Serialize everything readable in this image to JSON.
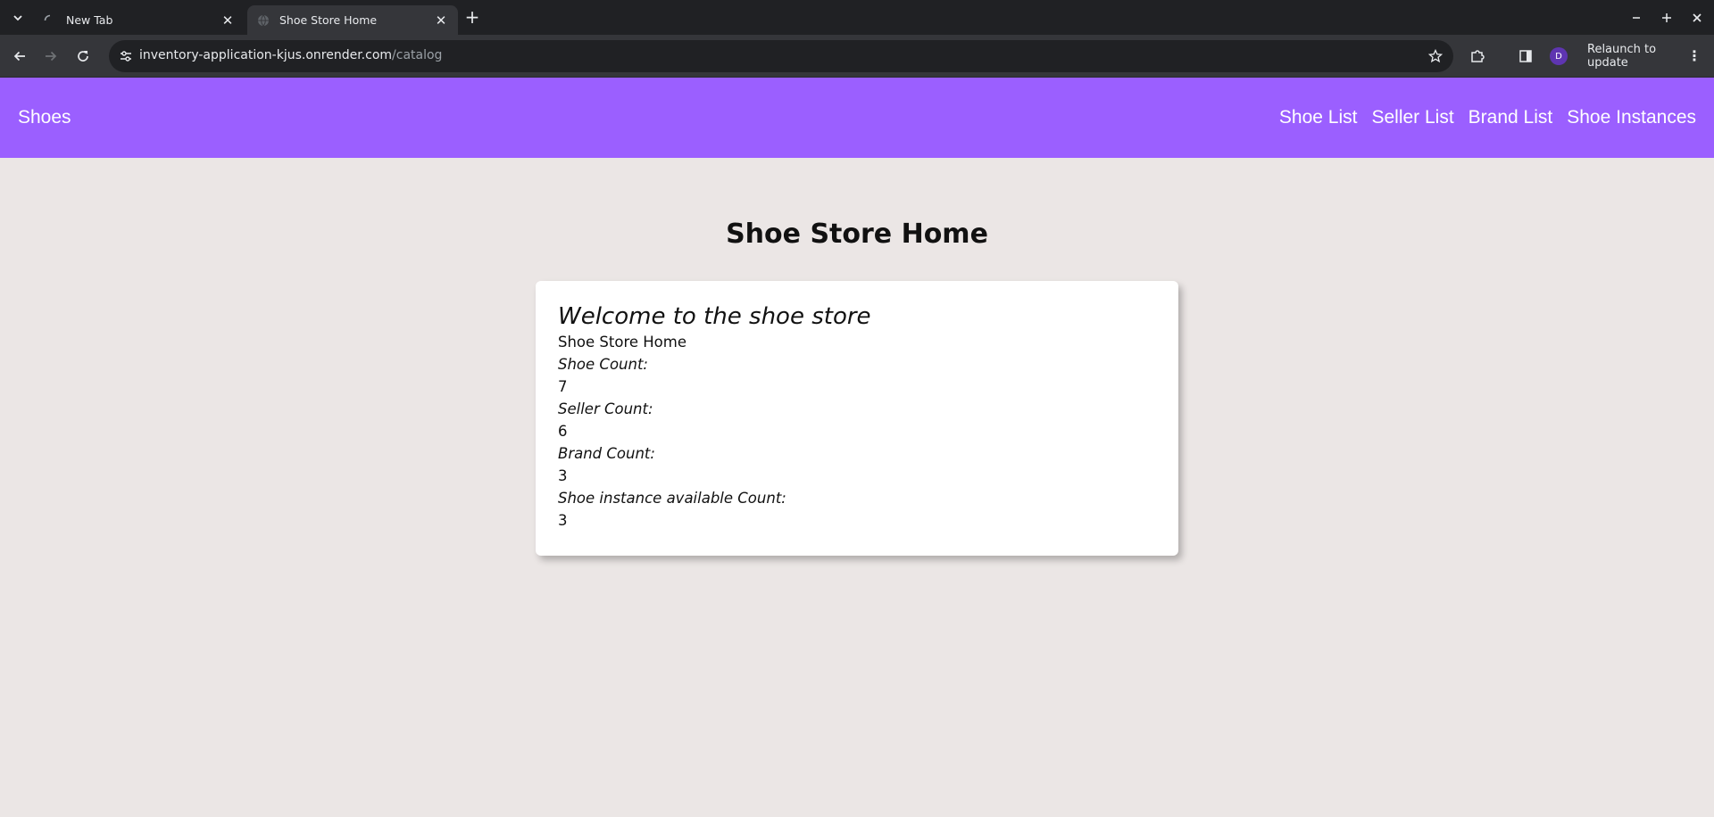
{
  "browser": {
    "tabs": [
      {
        "title": "New Tab",
        "active": false
      },
      {
        "title": "Shoe Store Home",
        "active": true
      }
    ],
    "address": {
      "host": "inventory-application-kjus.onrender.com",
      "path": "/catalog"
    },
    "profile_initial": "D",
    "relaunch_label": "Relaunch to update"
  },
  "nav": {
    "brand": "Shoes",
    "links": [
      "Shoe List",
      "Seller List",
      "Brand List",
      "Shoe Instances"
    ],
    "color": "#9b5fff"
  },
  "page": {
    "title": "Shoe Store Home",
    "card": {
      "welcome": "Welcome to the shoe store",
      "subtitle": "Shoe Store Home",
      "stats": [
        {
          "label": "Shoe Count:",
          "value": "7"
        },
        {
          "label": "Seller Count:",
          "value": "6"
        },
        {
          "label": "Brand Count:",
          "value": "3"
        },
        {
          "label": "Shoe instance available Count:",
          "value": "3"
        }
      ]
    }
  }
}
